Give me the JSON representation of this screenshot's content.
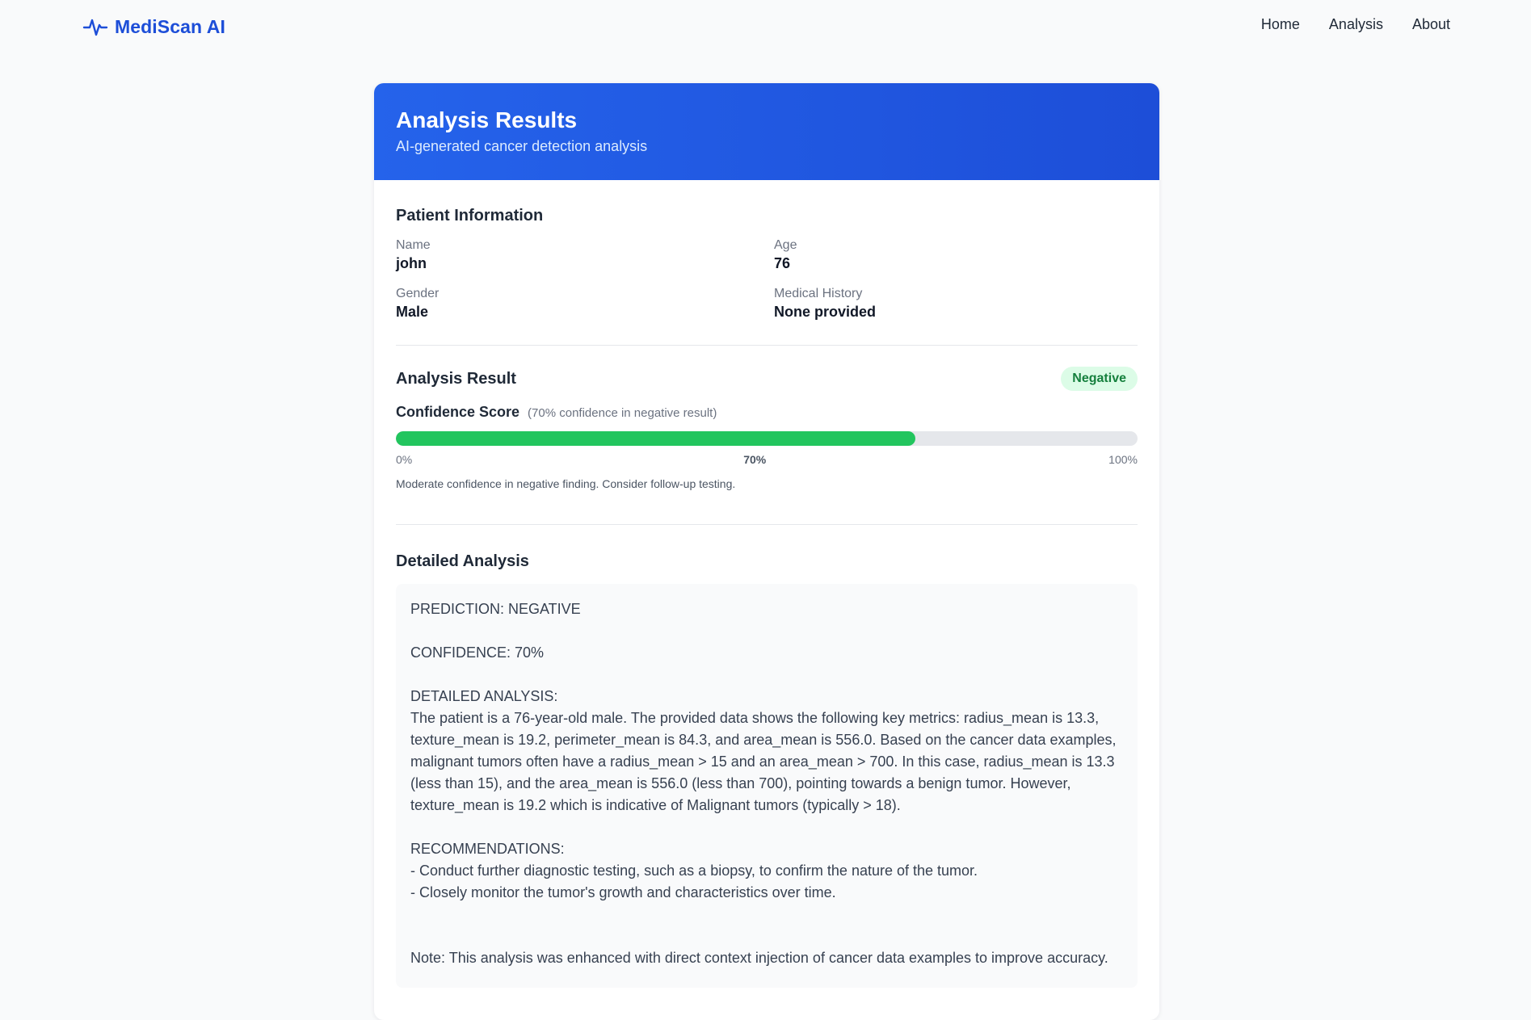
{
  "brand": {
    "name": "MediScan AI",
    "icon": "pulse-icon",
    "color": "#1d4ed8"
  },
  "nav": {
    "items": [
      "Home",
      "Analysis",
      "About"
    ]
  },
  "header": {
    "title": "Analysis Results",
    "subtitle": "AI-generated cancer detection analysis"
  },
  "patient": {
    "title": "Patient Information",
    "fields": [
      {
        "label": "Name",
        "value": "john"
      },
      {
        "label": "Age",
        "value": "76"
      },
      {
        "label": "Gender",
        "value": "Male"
      },
      {
        "label": "Medical History",
        "value": "None provided"
      }
    ]
  },
  "result": {
    "title": "Analysis Result",
    "badge": "Negative",
    "badge_color": "#15803d",
    "confidence_label": "Confidence Score",
    "confidence_note": "(70% confidence in negative result)",
    "confidence_value": 70,
    "bar_color": "#22c55e",
    "scale_min": "0%",
    "scale_mid": "70%",
    "scale_max": "100%",
    "help_text": "Moderate confidence in negative finding. Consider follow-up testing."
  },
  "detail": {
    "title": "Detailed Analysis",
    "prediction": "PREDICTION: NEGATIVE",
    "confidence": "CONFIDENCE: 70%",
    "analysis_heading": "DETAILED ANALYSIS:",
    "analysis_text": "The patient is a 76-year-old male. The provided data shows the following key metrics: radius_mean is 13.3, texture_mean is 19.2, perimeter_mean is 84.3, and area_mean is 556.0. Based on the cancer data examples, malignant tumors often have a radius_mean > 15 and an area_mean > 700. In this case, radius_mean is 13.3 (less than 15), and the area_mean is 556.0 (less than 700), pointing towards a benign tumor. However, texture_mean is 19.2 which is indicative of Malignant tumors (typically > 18).",
    "recommendations_heading": "RECOMMENDATIONS:",
    "recommendations": [
      "- Conduct further diagnostic testing, such as a biopsy, to confirm the nature of the tumor.",
      "- Closely monitor the tumor's growth and characteristics over time."
    ],
    "note": "Note: This analysis was enhanced with direct context injection of cancer data examples to improve accuracy."
  }
}
